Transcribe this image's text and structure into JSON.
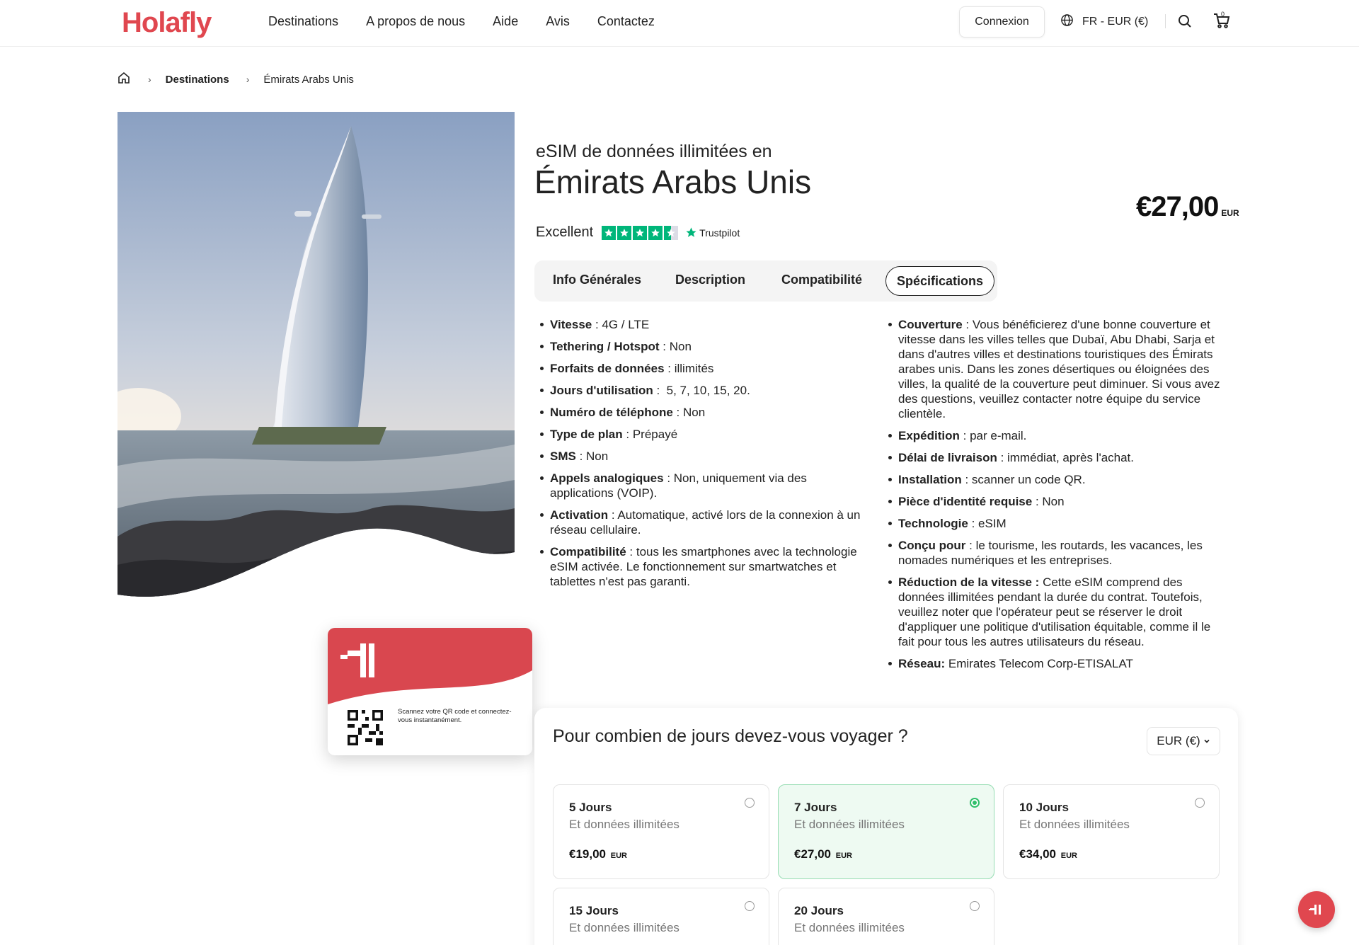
{
  "header": {
    "logo": "Holafly",
    "nav": [
      "Destinations",
      "A propos de nous",
      "Aide",
      "Avis",
      "Contactez"
    ],
    "login_label": "Connexion",
    "locale_label": "FR - EUR (€)",
    "cart_count": "0",
    "icons": [
      "globe-icon",
      "search-icon",
      "cart-icon"
    ]
  },
  "breadcrumb": {
    "home_icon": "home-icon",
    "items": [
      "Destinations",
      "Émirats Arabs Unis"
    ]
  },
  "hero": {
    "sim_card_text": "Scannez votre QR code et connectez-vous instantanément."
  },
  "product": {
    "subtitle": "eSIM de données illimitées en",
    "title": "Émirats Arabs Unis",
    "price": "€27,00",
    "price_currency": "EUR",
    "rating_label": "Excellent",
    "rating_source": "Trustpilot",
    "rating_stars": 4.5
  },
  "tabs": [
    "Info Générales",
    "Description",
    "Compatibilité",
    "Spécifications"
  ],
  "active_tab": "Spécifications",
  "specs_left": [
    {
      "label": "Vitesse",
      "sep": " : ",
      "value": "4G / LTE"
    },
    {
      "label": "Tethering / Hotspot",
      "sep": " : ",
      "value": "Non"
    },
    {
      "label": "Forfaits de données",
      "sep": " : ",
      "value": "illimités"
    },
    {
      "label": "Jours d'utilisation",
      "sep": " :  ",
      "value": "5, 7, 10, 15, 20."
    },
    {
      "label": "Numéro de téléphone",
      "sep": " : ",
      "value": "Non"
    },
    {
      "label": "Type de plan",
      "sep": " : ",
      "value": "Prépayé"
    },
    {
      "label": "SMS",
      "sep": " : ",
      "value": "Non"
    },
    {
      "label": "Appels analogiques",
      "sep": " : ",
      "value": "Non, uniquement via des applications (VOIP)."
    },
    {
      "label": "Activation",
      "sep": " : ",
      "value": "Automatique, activé lors de la connexion à un réseau cellulaire."
    },
    {
      "label": "Compatibilité",
      "sep": " : ",
      "value": "tous les smartphones avec la technologie eSIM activée. Le fonctionnement sur smartwatches et tablettes n'est pas garanti."
    }
  ],
  "specs_right": [
    {
      "label": "Couverture",
      "sep": " : ",
      "value": "Vous bénéficierez d'une bonne couverture et vitesse dans les villes telles que Dubaï, Abu Dhabi, Sarja et dans d'autres villes et destinations touristiques des Émirats arabes unis. Dans les zones désertiques ou éloignées des villes, la qualité de la couverture peut diminuer. Si vous avez des questions, veuillez contacter notre équipe du service clientèle."
    },
    {
      "label": "Expédition",
      "sep": " : ",
      "value": "par e-mail."
    },
    {
      "label": "Délai de livraison",
      "sep": " : ",
      "value": "immédiat, après l'achat."
    },
    {
      "label": "Installation",
      "sep": " : ",
      "value": "scanner un code QR."
    },
    {
      "label": "Pièce d'identité requise",
      "sep": " : ",
      "value": "Non"
    },
    {
      "label": "Technologie",
      "sep": " : ",
      "value": "eSIM"
    },
    {
      "label": "Conçu pour",
      "sep": " : ",
      "value": "le tourisme, les routards, les vacances, les nomades numériques et les entreprises."
    },
    {
      "label": "Réduction de la vitesse :",
      "sep": " ",
      "value": "Cette eSIM comprend des données illimitées pendant la durée du contrat. Toutefois, veuillez noter que l'opérateur peut se réserver le droit d'appliquer une politique d'utilisation équitable, comme il le fait pour tous les autres utilisateurs du réseau."
    },
    {
      "label": "Réseau:",
      "sep": " ",
      "value": "Emirates Telecom Corp-ETISALAT"
    }
  ],
  "days": {
    "question": "Pour combien de jours devez-vous voyager ?",
    "currency": "EUR (€)",
    "plans": [
      {
        "days": "5 Jours",
        "sub": "Et données illimitées",
        "price": "€19,00",
        "currency": "EUR",
        "selected": false
      },
      {
        "days": "7 Jours",
        "sub": "Et données illimitées",
        "price": "€27,00",
        "currency": "EUR",
        "selected": true
      },
      {
        "days": "10 Jours",
        "sub": "Et données illimitées",
        "price": "€34,00",
        "currency": "EUR",
        "selected": false
      },
      {
        "days": "15 Jours",
        "sub": "Et données illimitées",
        "price": "",
        "currency": "",
        "selected": false
      },
      {
        "days": "20 Jours",
        "sub": "Et données illimitées",
        "price": "",
        "currency": "",
        "selected": false
      }
    ]
  },
  "colors": {
    "brand": "#e0474f",
    "trustpilot_green": "#00b67a",
    "selected_plan_bg": "#eefaf2",
    "radio_selected": "#2fbf6a"
  }
}
